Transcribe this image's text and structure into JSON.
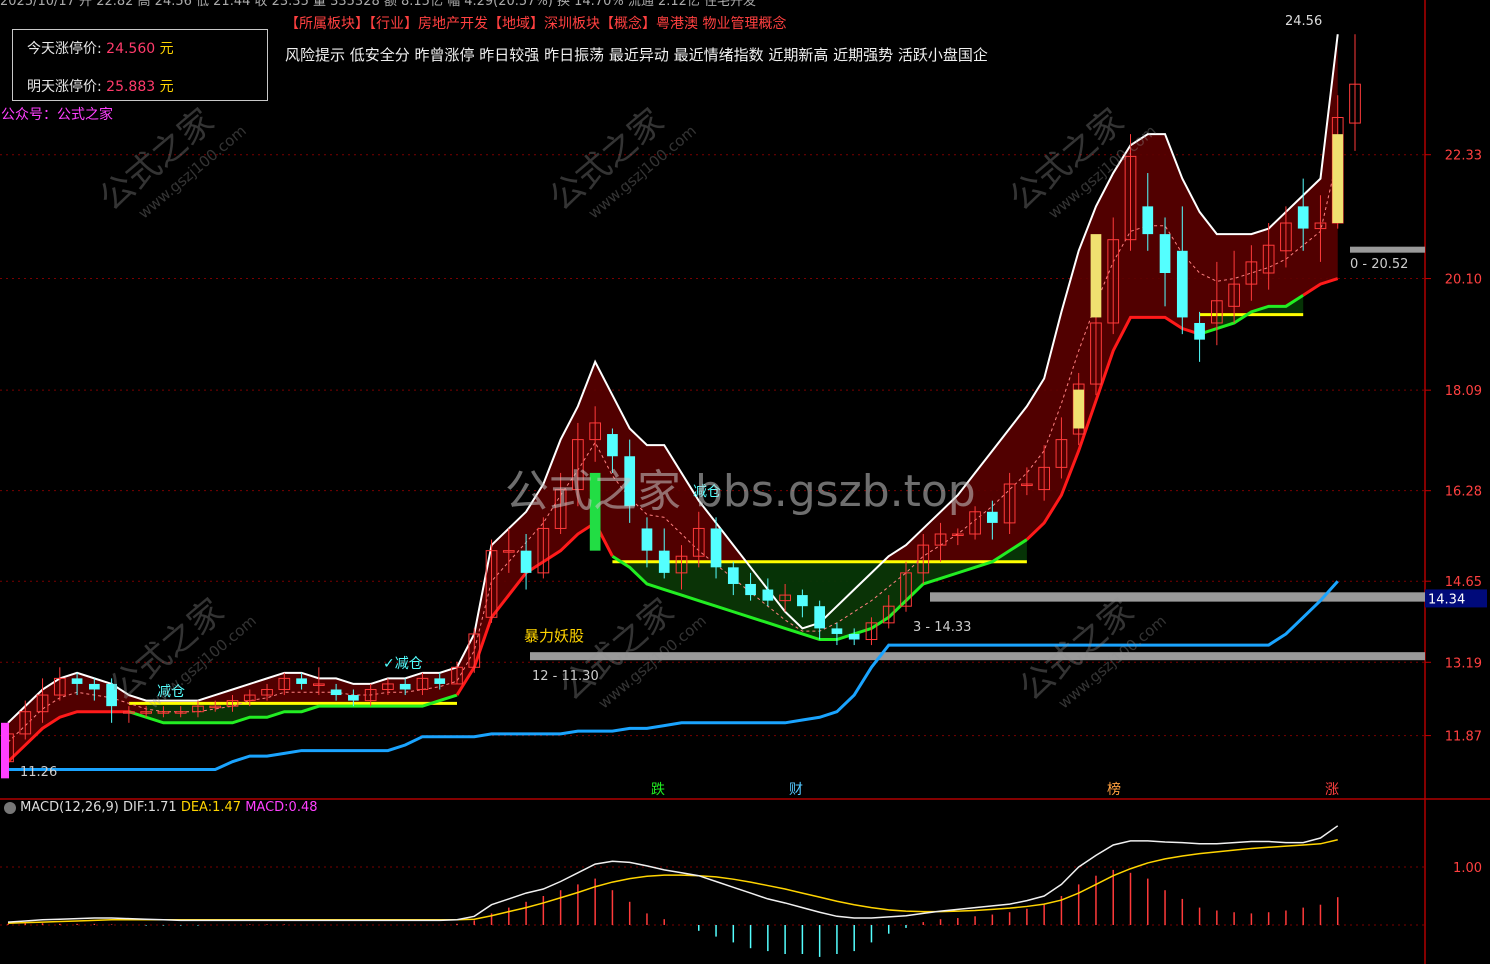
{
  "header": {
    "top_truncated": "2025/10/17 开 22.82 高 24.56 低 21.44 收 23.35 量 335328 额 8.15亿 幅 4.29(20.57%) 换 14.70% 流通 2.12亿 住宅开发"
  },
  "limit_box": {
    "today_label": "今天涨停价:",
    "today_value": "24.560",
    "tomorrow_label": "明天涨停价:",
    "tomorrow_value": "25.883",
    "unit": "元"
  },
  "wechat": "公众号：公式之家",
  "tags": {
    "line": "【所属板块】【行业】房地产开发【地域】深圳板块【概念】粤港澳 物业管理概念",
    "risk": "风险提示 低安全分 昨曾涨停 昨日较强 昨日振荡 最近异动 最近情绪指数 近期新高 近期强势 活跃小盘国企"
  },
  "watermark": "公式之家 bbs.gszb.top",
  "watermark_small": [
    "公式之家",
    "www.gszj100.com"
  ],
  "annotations": {
    "reduce1": "减仓",
    "reduce2": "✓减仓",
    "reduce3": "减仓",
    "violent": "暴力妖股",
    "level_1130": "12 - 11.30",
    "level_1433": "3 - 14.33",
    "level_2052": "0 - 20.52",
    "high_label": "24.56",
    "low_label": "11.26",
    "bottom_markers": [
      "跌",
      "财",
      "榜",
      "涨"
    ]
  },
  "macd": {
    "name": "MACD(12,26,9)",
    "dif_label": "DIF:",
    "dif": "1.71",
    "dea_label": "DEA:",
    "dea": "1.47",
    "macd_label": "MACD:",
    "macd_value": "0.48",
    "axis_tick": "1.00"
  },
  "colors": {
    "up": "#ff3a3a",
    "down": "#54ffff",
    "upper_band": "#ffffff",
    "lower_band_red": "#ff1a1a",
    "lower_band_green": "#22ee22",
    "lower_band_yellow": "#ffff00",
    "support": "#1aa4ff",
    "fill_upper": "#5a0000",
    "fill_lower": "#063606",
    "grid": "#7a0000"
  },
  "chart_data": {
    "type": "candlestick",
    "price_axis": {
      "ticks": [
        "22.33",
        "20.10",
        "18.09",
        "16.28",
        "14.65",
        "13.19",
        "11.87"
      ],
      "current_marker": "14.34",
      "ylim": [
        10.8,
        24.9
      ]
    },
    "candles": [
      [
        11.4,
        11.9,
        11.3,
        12.1
      ],
      [
        11.9,
        12.3,
        11.8,
        12.5
      ],
      [
        12.3,
        12.6,
        12.1,
        12.9
      ],
      [
        12.6,
        12.9,
        12.5,
        13.1
      ],
      [
        12.9,
        12.8,
        12.6,
        13.0
      ],
      [
        12.8,
        12.7,
        12.5,
        12.9
      ],
      [
        12.8,
        12.4,
        12.1,
        12.9
      ],
      [
        12.3,
        12.3,
        12.1,
        12.4
      ],
      [
        12.3,
        12.3,
        12.2,
        12.4
      ],
      [
        12.3,
        12.3,
        12.2,
        12.4
      ],
      [
        12.3,
        12.3,
        12.2,
        12.4
      ],
      [
        12.3,
        12.4,
        12.2,
        12.5
      ],
      [
        12.4,
        12.4,
        12.3,
        12.5
      ],
      [
        12.4,
        12.5,
        12.3,
        12.6
      ],
      [
        12.5,
        12.6,
        12.4,
        12.7
      ],
      [
        12.6,
        12.7,
        12.5,
        12.8
      ],
      [
        12.7,
        12.9,
        12.6,
        13.0
      ],
      [
        12.9,
        12.8,
        12.7,
        13.0
      ],
      [
        12.8,
        12.8,
        12.6,
        13.1
      ],
      [
        12.7,
        12.6,
        12.5,
        12.8
      ],
      [
        12.6,
        12.5,
        12.4,
        12.7
      ],
      [
        12.5,
        12.7,
        12.4,
        12.8
      ],
      [
        12.7,
        12.8,
        12.6,
        12.9
      ],
      [
        12.8,
        12.7,
        12.6,
        12.9
      ],
      [
        12.7,
        12.9,
        12.6,
        13.0
      ],
      [
        12.9,
        12.8,
        12.7,
        13.0
      ],
      [
        12.8,
        13.1,
        12.8,
        13.2
      ],
      [
        13.1,
        13.7,
        13.0,
        13.8
      ],
      [
        14.0,
        15.2,
        13.9,
        15.4
      ],
      [
        15.2,
        15.2,
        14.8,
        15.6
      ],
      [
        15.2,
        14.8,
        14.5,
        15.5
      ],
      [
        14.8,
        15.6,
        14.7,
        15.8
      ],
      [
        15.6,
        16.3,
        15.5,
        16.6
      ],
      [
        16.3,
        17.2,
        16.0,
        17.5
      ],
      [
        17.2,
        17.5,
        16.8,
        17.8
      ],
      [
        17.3,
        16.9,
        16.6,
        17.4
      ],
      [
        16.9,
        16.0,
        15.7,
        17.2
      ],
      [
        15.6,
        15.2,
        14.9,
        15.8
      ],
      [
        15.2,
        14.8,
        14.7,
        15.6
      ],
      [
        14.8,
        15.1,
        14.5,
        15.3
      ],
      [
        15.1,
        15.6,
        14.9,
        15.9
      ],
      [
        15.6,
        14.9,
        14.7,
        15.8
      ],
      [
        14.9,
        14.6,
        14.4,
        15.0
      ],
      [
        14.6,
        14.4,
        14.3,
        14.8
      ],
      [
        14.5,
        14.3,
        14.2,
        14.7
      ],
      [
        14.3,
        14.4,
        14.1,
        14.6
      ],
      [
        14.4,
        14.2,
        14.0,
        14.5
      ],
      [
        14.2,
        13.8,
        13.6,
        14.3
      ],
      [
        13.8,
        13.7,
        13.5,
        13.9
      ],
      [
        13.7,
        13.6,
        13.5,
        13.8
      ],
      [
        13.6,
        13.9,
        13.5,
        14.0
      ],
      [
        13.9,
        14.2,
        13.8,
        14.4
      ],
      [
        14.2,
        14.8,
        14.1,
        15.0
      ],
      [
        14.8,
        15.3,
        14.6,
        15.5
      ],
      [
        15.3,
        15.5,
        15.0,
        15.7
      ],
      [
        15.5,
        15.5,
        15.3,
        15.6
      ],
      [
        15.5,
        15.9,
        15.4,
        16.0
      ],
      [
        15.9,
        15.7,
        15.4,
        16.1
      ],
      [
        15.7,
        16.4,
        15.5,
        16.6
      ],
      [
        16.4,
        16.4,
        16.2,
        16.7
      ],
      [
        16.3,
        16.7,
        16.1,
        17.1
      ],
      [
        16.7,
        17.2,
        16.5,
        17.6
      ],
      [
        17.3,
        18.2,
        17.1,
        18.4
      ],
      [
        18.2,
        19.3,
        18.0,
        19.6
      ],
      [
        19.3,
        20.8,
        19.1,
        21.2
      ],
      [
        20.8,
        22.3,
        20.6,
        22.7
      ],
      [
        21.4,
        20.9,
        20.6,
        22.0
      ],
      [
        20.9,
        20.2,
        19.6,
        21.2
      ],
      [
        20.6,
        19.4,
        19.1,
        21.4
      ],
      [
        19.3,
        19.0,
        18.6,
        19.5
      ],
      [
        19.3,
        19.7,
        18.9,
        20.4
      ],
      [
        19.6,
        20.0,
        19.3,
        20.6
      ],
      [
        20.0,
        20.4,
        19.7,
        20.7
      ],
      [
        20.2,
        20.7,
        19.9,
        21.1
      ],
      [
        20.6,
        21.1,
        20.3,
        21.4
      ],
      [
        21.4,
        21.0,
        20.6,
        21.9
      ],
      [
        21.0,
        21.1,
        20.4,
        21.6
      ],
      [
        21.1,
        23.0,
        21.0,
        23.4
      ],
      [
        22.9,
        23.6,
        22.4,
        24.5
      ]
    ],
    "upper_band": [
      12.1,
      12.4,
      12.7,
      12.9,
      13.0,
      12.9,
      12.8,
      12.6,
      12.5,
      12.5,
      12.5,
      12.5,
      12.6,
      12.7,
      12.8,
      12.9,
      13.0,
      13.0,
      12.9,
      12.9,
      12.8,
      12.8,
      12.9,
      12.9,
      13.0,
      13.0,
      13.1,
      13.7,
      15.3,
      15.6,
      15.9,
      16.4,
      17.2,
      17.8,
      18.6,
      18.0,
      17.4,
      17.1,
      17.1,
      16.6,
      16.1,
      15.7,
      15.3,
      14.9,
      14.5,
      14.1,
      13.8,
      13.9,
      14.2,
      14.5,
      14.8,
      15.1,
      15.3,
      15.6,
      15.9,
      16.2,
      16.6,
      17.0,
      17.4,
      17.8,
      18.3,
      19.5,
      20.6,
      21.4,
      22.0,
      22.5,
      22.7,
      22.7,
      21.9,
      21.3,
      20.9,
      20.9,
      20.9,
      21.0,
      21.3,
      21.6,
      21.9,
      24.5
    ],
    "lower_band": [
      11.4,
      11.7,
      12.0,
      12.2,
      12.3,
      12.3,
      12.3,
      12.3,
      12.2,
      12.1,
      12.1,
      12.1,
      12.1,
      12.1,
      12.2,
      12.2,
      12.3,
      12.3,
      12.4,
      12.4,
      12.4,
      12.4,
      12.4,
      12.4,
      12.4,
      12.5,
      12.6,
      13.1,
      14.0,
      14.4,
      14.8,
      15.0,
      15.2,
      15.5,
      15.7,
      15.1,
      14.9,
      14.6,
      14.5,
      14.4,
      14.3,
      14.2,
      14.1,
      14.0,
      13.9,
      13.8,
      13.7,
      13.6,
      13.6,
      13.7,
      13.8,
      14.0,
      14.3,
      14.6,
      14.7,
      14.8,
      14.9,
      15.0,
      15.2,
      15.4,
      15.7,
      16.2,
      17.0,
      17.9,
      18.8,
      19.4,
      19.4,
      19.4,
      19.2,
      19.1,
      19.2,
      19.3,
      19.5,
      19.6,
      19.6,
      19.8,
      20.0,
      20.1
    ],
    "support_line": [
      11.26,
      11.26,
      11.26,
      11.26,
      11.26,
      11.26,
      11.26,
      11.26,
      11.26,
      11.26,
      11.26,
      11.26,
      11.26,
      11.4,
      11.5,
      11.5,
      11.55,
      11.6,
      11.6,
      11.6,
      11.6,
      11.6,
      11.6,
      11.7,
      11.85,
      11.85,
      11.85,
      11.85,
      11.9,
      11.9,
      11.9,
      11.9,
      11.9,
      11.95,
      11.95,
      11.95,
      12.0,
      12.0,
      12.05,
      12.1,
      12.1,
      12.1,
      12.1,
      12.1,
      12.1,
      12.1,
      12.15,
      12.2,
      12.3,
      12.6,
      13.1,
      13.5,
      13.5,
      13.5,
      13.5,
      13.5,
      13.5,
      13.5,
      13.5,
      13.5,
      13.5,
      13.5,
      13.5,
      13.5,
      13.5,
      13.5,
      13.5,
      13.5,
      13.5,
      13.5,
      13.5,
      13.5,
      13.5,
      13.5,
      13.7,
      14.0,
      14.3,
      14.65
    ],
    "gray_levels": [
      13.3,
      14.3,
      14.45,
      20.62
    ],
    "macd_hist": [
      0.02,
      0.03,
      0.03,
      0.02,
      0.02,
      0.02,
      0.01,
      0.0,
      -0.01,
      -0.01,
      -0.01,
      -0.01,
      0.0,
      0.0,
      0.01,
      0.01,
      0.01,
      0.0,
      0.0,
      0.0,
      0.0,
      0.0,
      0.0,
      0.0,
      0.0,
      0.0,
      0.02,
      0.08,
      0.2,
      0.3,
      0.4,
      0.5,
      0.6,
      0.7,
      0.8,
      0.6,
      0.4,
      0.2,
      0.1,
      0.0,
      -0.1,
      -0.2,
      -0.3,
      -0.4,
      -0.45,
      -0.5,
      -0.5,
      -0.55,
      -0.5,
      -0.45,
      -0.3,
      -0.15,
      -0.05,
      0.05,
      0.1,
      0.12,
      0.15,
      0.18,
      0.22,
      0.28,
      0.35,
      0.5,
      0.7,
      0.85,
      0.95,
      0.9,
      0.8,
      0.6,
      0.45,
      0.3,
      0.25,
      0.22,
      0.2,
      0.22,
      0.25,
      0.3,
      0.35,
      0.48
    ],
    "dif": [
      0.05,
      0.07,
      0.09,
      0.1,
      0.11,
      0.12,
      0.12,
      0.11,
      0.1,
      0.09,
      0.08,
      0.08,
      0.08,
      0.08,
      0.08,
      0.08,
      0.08,
      0.08,
      0.08,
      0.08,
      0.08,
      0.08,
      0.08,
      0.08,
      0.08,
      0.08,
      0.09,
      0.15,
      0.35,
      0.45,
      0.55,
      0.62,
      0.75,
      0.9,
      1.05,
      1.1,
      1.08,
      1.02,
      0.95,
      0.9,
      0.85,
      0.75,
      0.65,
      0.55,
      0.45,
      0.38,
      0.3,
      0.22,
      0.15,
      0.12,
      0.12,
      0.14,
      0.16,
      0.2,
      0.24,
      0.27,
      0.3,
      0.33,
      0.36,
      0.42,
      0.5,
      0.7,
      1.0,
      1.2,
      1.38,
      1.45,
      1.45,
      1.43,
      1.42,
      1.4,
      1.4,
      1.42,
      1.44,
      1.44,
      1.42,
      1.42,
      1.5,
      1.71
    ],
    "dea": [
      0.03,
      0.04,
      0.05,
      0.06,
      0.07,
      0.08,
      0.09,
      0.09,
      0.09,
      0.09,
      0.09,
      0.09,
      0.09,
      0.09,
      0.09,
      0.09,
      0.09,
      0.09,
      0.09,
      0.09,
      0.09,
      0.09,
      0.09,
      0.09,
      0.09,
      0.09,
      0.09,
      0.1,
      0.16,
      0.23,
      0.3,
      0.38,
      0.47,
      0.56,
      0.66,
      0.74,
      0.8,
      0.84,
      0.86,
      0.86,
      0.85,
      0.83,
      0.79,
      0.74,
      0.68,
      0.62,
      0.55,
      0.48,
      0.41,
      0.35,
      0.3,
      0.26,
      0.24,
      0.23,
      0.23,
      0.24,
      0.25,
      0.27,
      0.29,
      0.32,
      0.36,
      0.43,
      0.55,
      0.7,
      0.85,
      0.97,
      1.07,
      1.14,
      1.19,
      1.23,
      1.26,
      1.29,
      1.32,
      1.34,
      1.36,
      1.38,
      1.4,
      1.47
    ]
  }
}
